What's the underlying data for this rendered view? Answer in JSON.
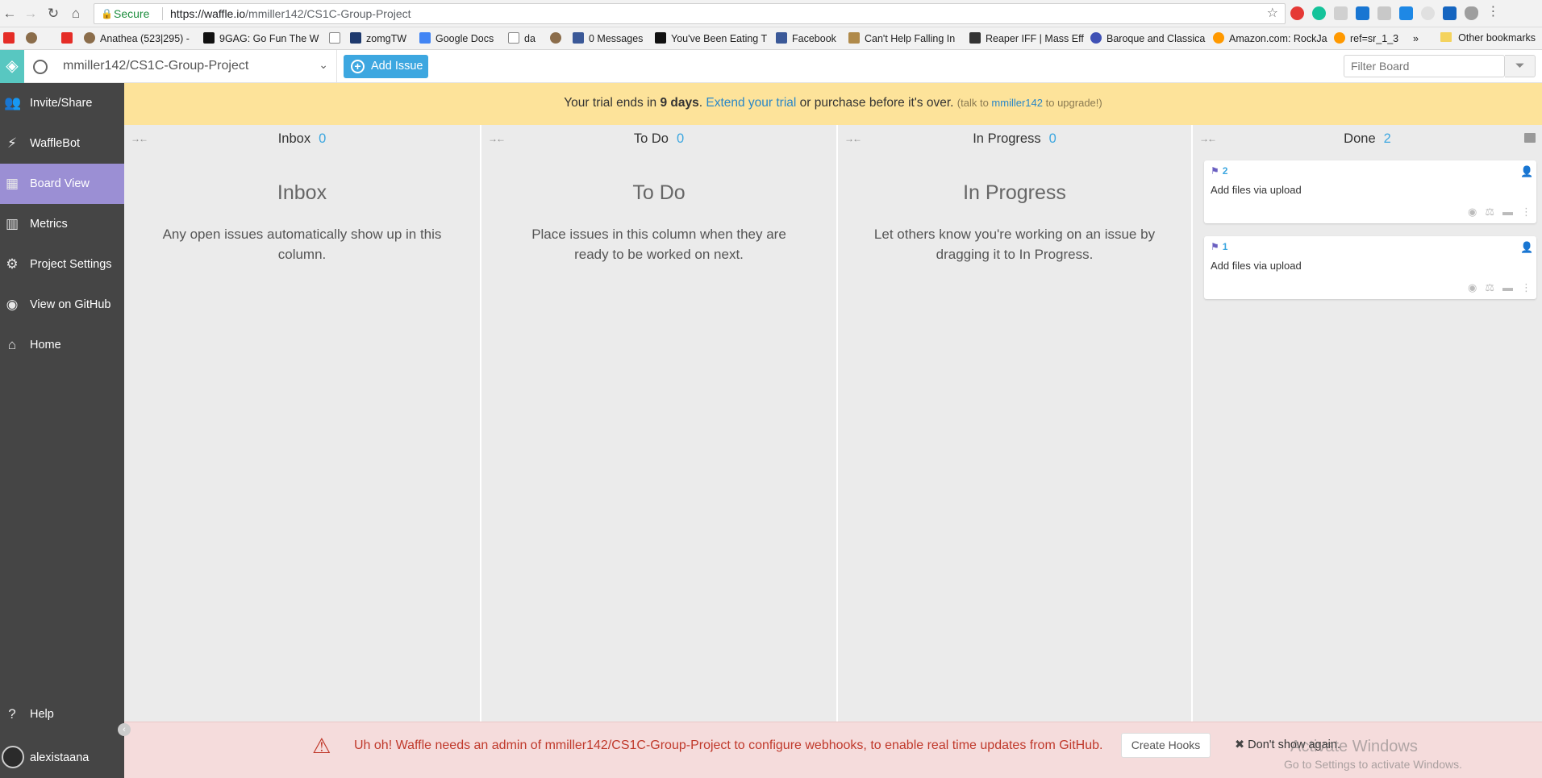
{
  "browser": {
    "secure_label": "Secure",
    "url_host": "https://waffle.io",
    "url_path": "/mmiller142/CS1C-Group-Project"
  },
  "bookmarks": [
    {
      "label": "",
      "color": "#e52d27"
    },
    {
      "label": "",
      "color": "#8b6d4b"
    },
    {
      "label": "",
      "color": "#e52d27"
    },
    {
      "label": "Anathea (523|295) -",
      "color": "#8b6d4b"
    },
    {
      "label": "9GAG: Go Fun The W",
      "color": "#111111"
    },
    {
      "label": "",
      "color": "#9e9e9e"
    },
    {
      "label": "zomgTW",
      "color": "#1e3a6e"
    },
    {
      "label": "Google Docs",
      "color": "#4285f4"
    },
    {
      "label": "da",
      "color": "#9e9e9e"
    },
    {
      "label": "",
      "color": "#8b6d4b"
    },
    {
      "label": "0 Messages",
      "color": "#3b5998"
    },
    {
      "label": "You've Been Eating T",
      "color": "#111111"
    },
    {
      "label": "Facebook",
      "color": "#3b5998"
    },
    {
      "label": "Can't Help Falling In",
      "color": "#b08a4a"
    },
    {
      "label": "Reaper IFF | Mass Eff",
      "color": "#333333"
    },
    {
      "label": "Baroque and Classica",
      "color": "#3f51b5"
    },
    {
      "label": "Amazon.com: RockJa",
      "color": "#ff9900"
    },
    {
      "label": "ref=sr_1_3",
      "color": "#ff9900"
    },
    {
      "label": "»",
      "color": ""
    }
  ],
  "other_bookmarks": "Other bookmarks",
  "topbar": {
    "project": "mmiller142/CS1C-Group-Project",
    "add_issue": "Add Issue",
    "filter_placeholder": "Filter Board"
  },
  "sidebar": {
    "items": [
      {
        "label": "Invite/Share",
        "icon": "users-icon"
      },
      {
        "label": "WaffleBot",
        "icon": "bolt-icon"
      },
      {
        "label": "Board View",
        "icon": "grid-icon"
      },
      {
        "label": "Metrics",
        "icon": "bar-chart-icon"
      },
      {
        "label": "Project Settings",
        "icon": "gear-icon"
      },
      {
        "label": "View on GitHub",
        "icon": "github-icon"
      },
      {
        "label": "Home",
        "icon": "home-icon"
      }
    ],
    "help": "Help",
    "user": "alexistaana"
  },
  "trial": {
    "prefix": "Your trial ends in",
    "days": "9 days",
    "dot": ".",
    "extend": "Extend your trial",
    "middle": "or purchase before it's over.",
    "talk_prefix": "(talk to",
    "talk_user": "mmiller142",
    "talk_suffix": "to upgrade!)"
  },
  "columns": [
    {
      "name": "Inbox",
      "count": "0",
      "title": "Inbox",
      "desc": "Any open issues automatically show up in this column."
    },
    {
      "name": "To Do",
      "count": "0",
      "title": "To Do",
      "desc": "Place issues in this column when they are ready to be worked on next."
    },
    {
      "name": "In Progress",
      "count": "0",
      "title": "In Progress",
      "desc": "Let others know you're working on an issue by dragging it to In Progress."
    },
    {
      "name": "Done",
      "count": "2"
    }
  ],
  "cards": [
    {
      "number": "2",
      "title": "Add files via upload"
    },
    {
      "number": "1",
      "title": "Add files via upload"
    }
  ],
  "warning": {
    "message": "Uh oh! Waffle needs an admin of mmiller142/CS1C-Group-Project to configure webhooks, to enable real time updates from GitHub.",
    "create_hooks": "Create Hooks",
    "dismiss": "Don't show again."
  },
  "watermark": {
    "line1": "Activate Windows",
    "line2": "Go to Settings to activate Windows."
  }
}
